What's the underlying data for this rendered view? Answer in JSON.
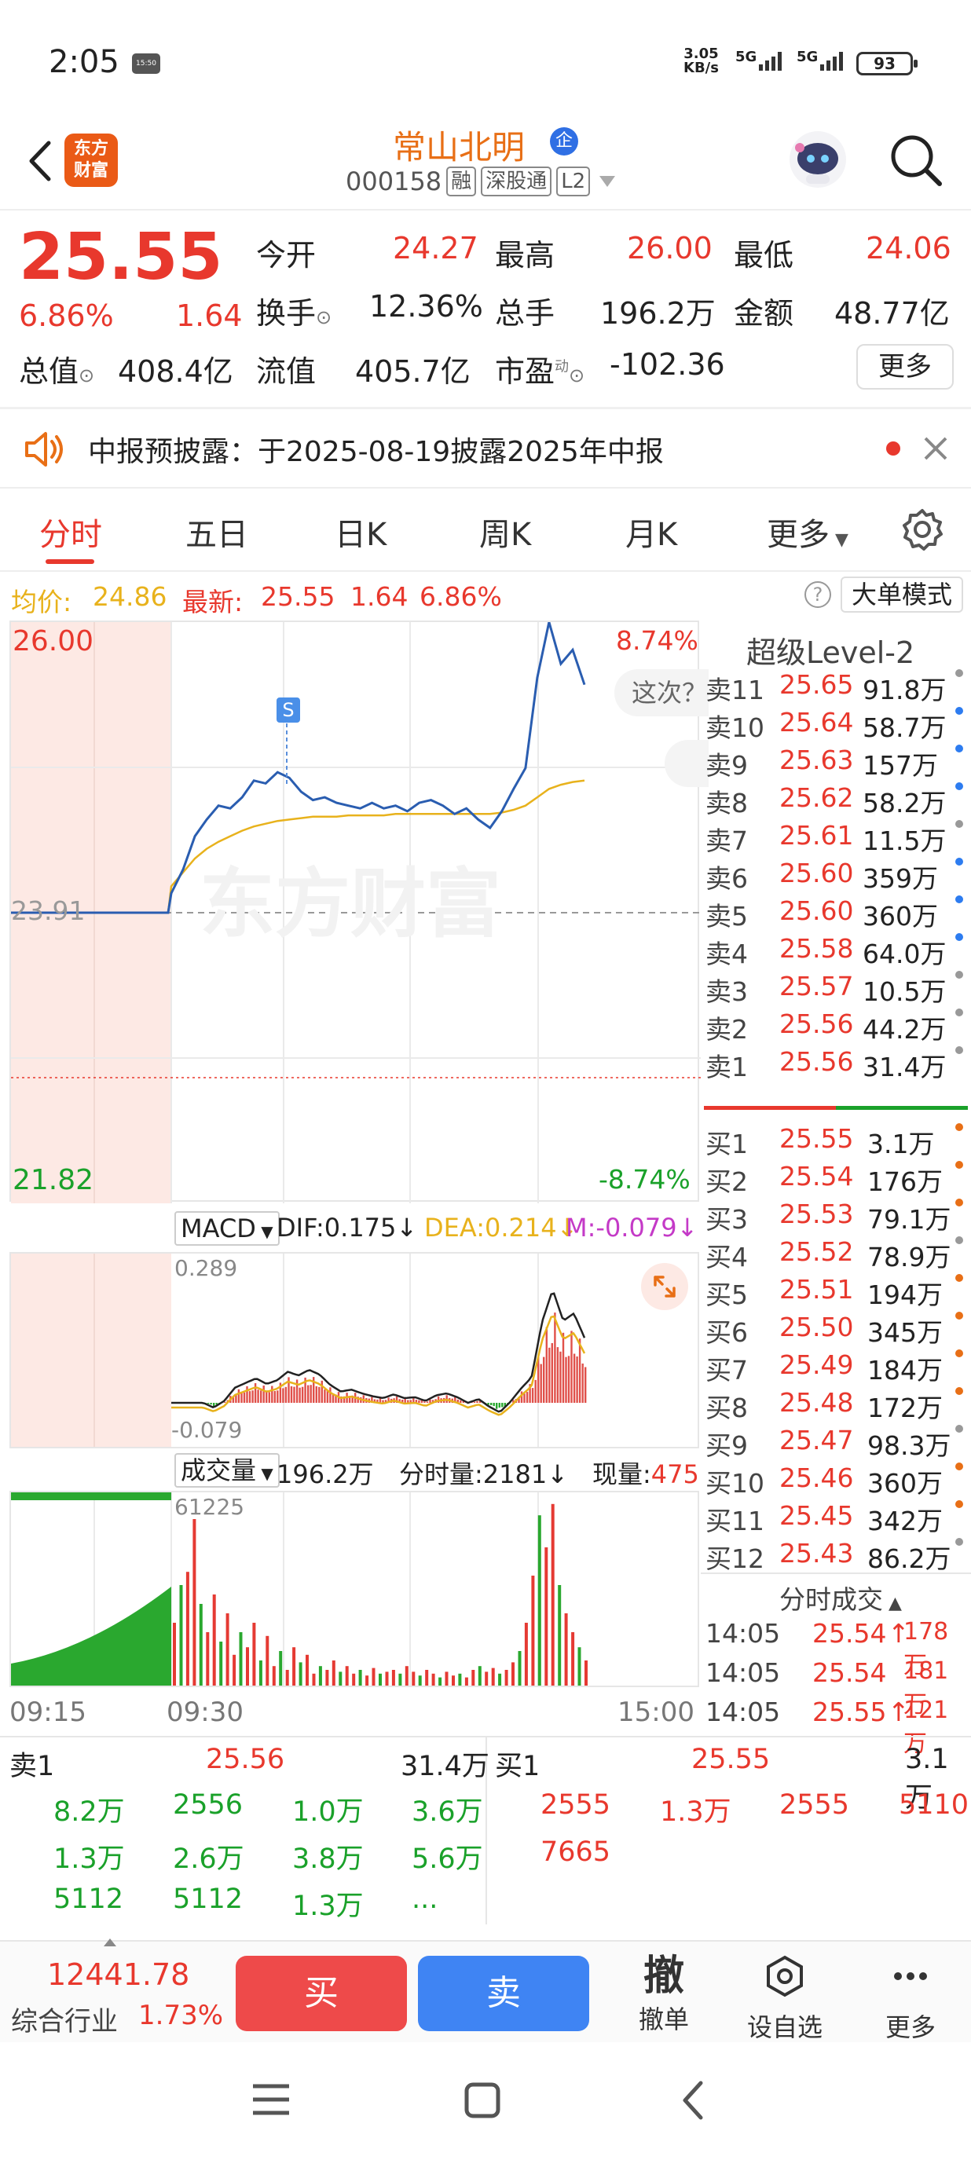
{
  "status_bar": {
    "time": "2:05",
    "notif_box": "15:50",
    "net_speed_value": "3.05",
    "net_speed_unit": "KB/s",
    "sig1": "5G",
    "sig2": "5G",
    "battery": "93"
  },
  "header": {
    "logo_text": "东方\n财富",
    "stock_name": "常山北明",
    "qi_badge": "企",
    "code": "000158",
    "tags": [
      "融",
      "深股通",
      "L2"
    ]
  },
  "quote": {
    "price": "25.55",
    "change_pct": "6.86%",
    "change_amt": "1.64",
    "row1": [
      {
        "label": "今开",
        "value": "24.27"
      },
      {
        "label": "最高",
        "value": "26.00"
      },
      {
        "label": "最低",
        "value": "24.06"
      }
    ],
    "row2": [
      {
        "label": "换手",
        "value": "12.36%"
      },
      {
        "label": "总手",
        "value": "196.2万"
      },
      {
        "label": "金额",
        "value": "48.77亿"
      }
    ],
    "row3": [
      {
        "label": "总值",
        "value": "408.4亿"
      },
      {
        "label": "流值",
        "value": "405.7亿"
      },
      {
        "label": "市盈",
        "sup": "动",
        "value": "-102.36"
      }
    ],
    "more": "更多"
  },
  "notice": {
    "text": "中报预披露：于2025-08-19披露2025年中报"
  },
  "tabs": [
    "分时",
    "五日",
    "日K",
    "周K",
    "月K",
    "更多"
  ],
  "avg_row": {
    "avg_label": "均价:",
    "avg_value": "24.86",
    "latest_label": "最新:",
    "latest_value": "25.55",
    "chg": "1.64",
    "pct": "6.86%",
    "mode_btn": "大单模式"
  },
  "chart": {
    "y_high": "26.00",
    "y_pct_high": "8.74%",
    "y_mid": "23.91",
    "y_low": "21.82",
    "y_pct_low": "-8.74%",
    "s_marker": "S",
    "watermark": "东方财富",
    "popup_text": "这次？"
  },
  "chart_data": {
    "type": "line",
    "series": [
      {
        "name": "最新",
        "values": [
          23.91,
          23.91,
          23.91,
          23.91,
          24.05,
          24.22,
          24.46,
          24.58,
          24.68,
          24.66,
          24.74,
          24.86,
          24.84,
          24.92,
          24.88,
          24.78,
          24.72,
          24.74,
          24.7,
          24.68,
          24.66,
          24.7,
          24.66,
          24.68,
          24.64,
          24.7,
          24.72,
          24.68,
          24.62,
          24.66,
          24.58,
          24.52,
          24.64,
          24.8,
          24.95,
          25.6,
          26.0,
          25.7,
          25.8,
          25.55
        ]
      },
      {
        "name": "均价",
        "values": [
          23.91,
          23.91,
          23.91,
          23.91,
          24.1,
          24.2,
          24.3,
          24.37,
          24.42,
          24.46,
          24.5,
          24.53,
          24.55,
          24.57,
          24.58,
          24.59,
          24.6,
          24.6,
          24.6,
          24.61,
          24.61,
          24.61,
          24.61,
          24.62,
          24.62,
          24.62,
          24.62,
          24.62,
          24.62,
          24.62,
          24.62,
          24.62,
          24.63,
          24.65,
          24.68,
          24.74,
          24.8,
          24.83,
          24.85,
          24.86
        ]
      }
    ],
    "ylim": [
      21.82,
      26.0
    ]
  },
  "macd": {
    "label": "MACD",
    "dif": "DIF:0.175",
    "dea": "DEA:0.214",
    "m": "M:-0.079",
    "top": "0.289",
    "bottom": "-0.079"
  },
  "volume": {
    "label": "成交量",
    "total": "196.2万",
    "tick_label": "分时量:",
    "tick_value": "2181",
    "now_label": "现量:",
    "now_value": "475",
    "top": "61225",
    "t_start": "09:15",
    "t_open": "09:30",
    "t_end": "15:00"
  },
  "level2": {
    "title": "超级Level-2",
    "asks": [
      {
        "label": "卖11",
        "price": "25.65",
        "vol": "91.8万",
        "dot": "#999999"
      },
      {
        "label": "卖10",
        "price": "25.64",
        "vol": "58.7万",
        "dot": "#2d7cf0"
      },
      {
        "label": "卖9",
        "price": "25.63",
        "vol": "157万",
        "dot": "#2d7cf0"
      },
      {
        "label": "卖8",
        "price": "25.62",
        "vol": "58.2万",
        "dot": "#2d7cf0"
      },
      {
        "label": "卖7",
        "price": "25.61",
        "vol": "11.5万",
        "dot": "#999999"
      },
      {
        "label": "卖6",
        "price": "25.60",
        "vol": "359万",
        "dot": "#2d7cf0"
      },
      {
        "label": "卖5",
        "price": "25.60",
        "vol": "360万",
        "dot": "#2d7cf0"
      },
      {
        "label": "卖4",
        "price": "25.58",
        "vol": "64.0万",
        "dot": "#2d7cf0"
      },
      {
        "label": "卖3",
        "price": "25.57",
        "vol": "10.5万",
        "dot": "#999999"
      },
      {
        "label": "卖2",
        "price": "25.56",
        "vol": "44.2万",
        "dot": "#999999"
      },
      {
        "label": "卖1",
        "price": "25.56",
        "vol": "31.4万",
        "dot": "#999999"
      }
    ],
    "bids": [
      {
        "label": "买1",
        "price": "25.55",
        "vol": "3.1万",
        "dot": "#e86f16"
      },
      {
        "label": "买2",
        "price": "25.54",
        "vol": "176万",
        "dot": "#e86f16"
      },
      {
        "label": "买3",
        "price": "25.53",
        "vol": "79.1万",
        "dot": "#e86f16"
      },
      {
        "label": "买4",
        "price": "25.52",
        "vol": "78.9万",
        "dot": "#999999"
      },
      {
        "label": "买5",
        "price": "25.51",
        "vol": "194万",
        "dot": "#e86f16"
      },
      {
        "label": "买6",
        "price": "25.50",
        "vol": "345万",
        "dot": "#e86f16"
      },
      {
        "label": "买7",
        "price": "25.49",
        "vol": "184万",
        "dot": "#e86f16"
      },
      {
        "label": "买8",
        "price": "25.48",
        "vol": "172万",
        "dot": "#e86f16"
      },
      {
        "label": "买9",
        "price": "25.47",
        "vol": "98.3万",
        "dot": "#999999"
      },
      {
        "label": "买10",
        "price": "25.46",
        "vol": "360万",
        "dot": "#e86f16"
      },
      {
        "label": "买11",
        "price": "25.45",
        "vol": "342万",
        "dot": "#e86f16"
      },
      {
        "label": "买12",
        "price": "25.43",
        "vol": "86.2万",
        "dot": "#999999"
      }
    ],
    "ticks_title": "分时成交",
    "ticks": [
      {
        "time": "14:05",
        "price": "25.54",
        "arrow": "↑",
        "vol": "178万"
      },
      {
        "time": "14:05",
        "price": "25.54",
        "arrow": "",
        "vol": "181万"
      },
      {
        "time": "14:05",
        "price": "25.55",
        "arrow": "↑",
        "vol": "121万"
      }
    ]
  },
  "depth": {
    "sell_label": "卖1",
    "sell_price": "25.56",
    "sell_vol": "31.4万",
    "buy_label": "买1",
    "buy_price": "25.55",
    "buy_vol": "3.1万",
    "sell_orders": [
      [
        "8.2万",
        "2556",
        "1.0万",
        "3.6万"
      ],
      [
        "1.3万",
        "2.6万",
        "3.8万",
        "5.6万"
      ],
      [
        "5112",
        "5112",
        "1.3万",
        "..."
      ]
    ],
    "buy_orders": [
      [
        "2555",
        "1.3万",
        "2555",
        "5110"
      ],
      [
        "7665",
        "",
        "",
        ""
      ]
    ]
  },
  "action_bar": {
    "index_value": "12441.78",
    "index_label": "综合行业",
    "index_pct": "1.73%",
    "buy": "买",
    "sell": "卖",
    "cancel_icon": "撤",
    "cancel": "撤单",
    "watchlist": "设自选",
    "more": "更多"
  }
}
